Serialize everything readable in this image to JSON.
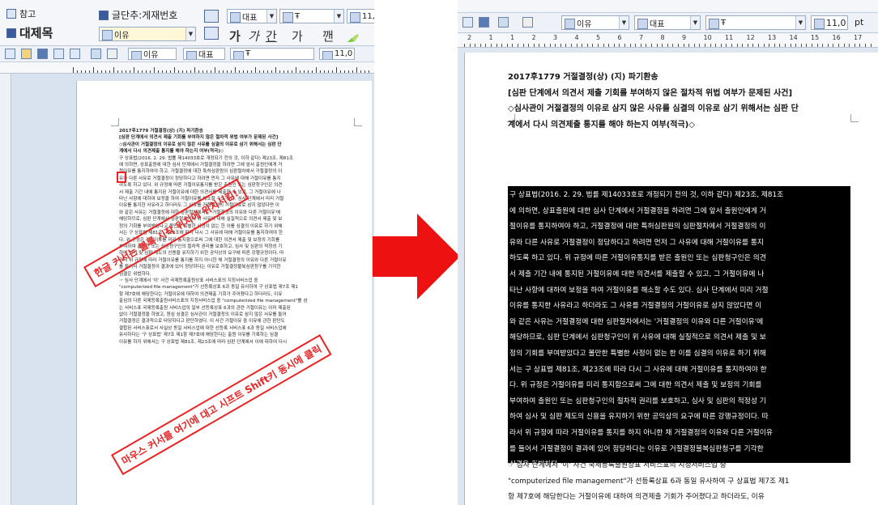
{
  "left": {
    "menu": {
      "ref": "참고",
      "heading": "대제목",
      "bullet_style": "글단추:게재번호",
      "style_combo": "이유",
      "style_combo2": "이유",
      "font_face": "대표",
      "font_face2": "대표",
      "font_name": "Ŧ",
      "font_name2": "Ŧ",
      "size_value": "11,0"
    },
    "format_buttons": [
      "가",
      "가",
      "간",
      "가",
      "깬"
    ],
    "callout_top": "한글 커서는 블록 시작 위치에 위치시킴!",
    "callout_bottom": "마우스 커서를 여기에 대고 시프트 Shift키 동시에 클릭"
  },
  "right": {
    "toolbar": {
      "style_combo": "이유",
      "font_face": "대표",
      "font_name": "Ŧ",
      "size_value": "11,0",
      "size_unit": "pt"
    },
    "ruler_numbers": [
      "2",
      "1",
      "1",
      "2",
      "3",
      "4",
      "5",
      "6",
      "7",
      "8",
      "9",
      "10",
      "11",
      "12",
      "13",
      "14",
      "15",
      "16",
      "17"
    ]
  },
  "doc": {
    "case_line": "2017후1779 거절결정(상) (지) 파기환송",
    "issue_line1": "[심판 단계에서 의견서 제출 기회를 부여하지 않은 절차적 위법 여부가 문제된 사건]",
    "issue_line2": "◇심사관이 거절결정의 이유로 삼지 않은 사유를 심결의 이유로 삼기 위해서는 심판 단",
    "issue_line3": "계에서 다시 의견제출 통지를 해야 하는지 여부(적극)◇",
    "selected_lines": [
      "구 상표법(2016. 2. 29. 법률 제14033호로 개정되기 전의 것, 이하 같다) 제23조, 제81조",
      "에 의하면, 상표출원에 대한 심사 단계에서 거절결정을 하려면 그에 앞서 출원인에게 거",
      "절이유를 통지하여야 하고, 거절결정에 대한 특허심판원의 심판절차에서 거절결정의 이",
      "유와 다른 사유로 거절결정이 정당하다고 하려면 먼저 그 사유에 대해 거절이유를 통지",
      "하도록 하고 있다. 위 규정에 따른 거절이유통지를 받은 출원인 또는 심판청구인은 의견",
      "서 제출 기간 내에 통지된 거절이유에 대한 의견서를 제출할 수 있고, 그 거절이유에 나",
      "타난 사항에 대하여 보정을 하여 거절이유를 해소할 수도 있다. 심사 단계에서 미리 거절",
      "이유를 통지한 사유라고 하더라도 그 사유를 거절결정의 거절이유로 삼지 않았다면 이",
      "와 같은 사유는 거절결정에 대한 심판절차에서는 '거절결정의 이유와 다른 거절이유'에",
      "해당하므로, 심판 단계에서 심판청구인이 위 사유에 대해 실질적으로 의견서 제출 및 보",
      "정의 기회를 부여받았다고 볼만한 특별한 사정이 없는 한 이를 심결의 이유로 하기 위해",
      "서는 구 상표법 제81조, 제23조에 따라 다시 그 사유에 대해 거절이유를 통지하여야 한",
      "다. 위 규정은 거절이유를 미리 통지함으로써 그에 대한 의견서 제출 및 보정의 기회를",
      "부여하여 출원인 또는 심판청구인의 절차적 권리를 보호하고, 심사 및 심판의 적정성 기",
      "하여 심사 및 심판 제도의 신용을 유지하기 위한 공익상의 요구에 따른 강행규정이다. 따",
      "라서 위 규정에 따라 거절이유를 통지를 하지 아니한 채 거절결정의 이유와 다른 거절이유",
      "를 들어서 거절결정이 결과에 있어 정당하다는 이유로 거절결정불복심판청구를 기각한",
      "심결은 위법하다."
    ],
    "after_lines": [
      "☞ 심사 단계에서 '이' 사건 국제등록출원상표 서비스표의 지정서비스업 중",
      "\"computerized file management\"가 선등록상표 6과 동일 유사하여 구 상표법 제7조 제1",
      "항 제7호에 해당한다는 거절이유에 대하여 의견제출 기회가 주어졌다고 하더라도, 이유"
    ],
    "small_after_lines": [
      "☞ 심사 단계에서 '이' 사건 국제등록출원상표 서비스표의 지정서비스업 중",
      "\"computerized file management\"가 선등록상표 6과 동일 유사하여 구 상표법 제7조 제1",
      "항 제7호에 해당한다는 거절이유에 대하여 의견제출 기회가 주어졌다고 하더라도, 이유",
      "출심의 다른 국제등록출원서비스표의 지정서비스업 중 \"computerized file management\"를 삼",
      "는 서비스표 국제등록출원 서비스업의 일부 선등록상표 6과의 관련 거절이유는 이미 제출된",
      "없이 거절결정을 하였고, 원심 심결은 심사관이 거절결정의 이유로 삼지 않은 사유를 들어",
      "거절결정은 결과적으로 타당하다고 판단하였다. 이 사건 거절이유 중 이유에 관한 판단도",
      "결합된 서비스표로서 사실상 동일 서비스업에 대한 선등록 서비스표 6과 동일 서비스업에",
      "유사하다는 '구 상표법' 제7조 제1항 제7호에 해당한다는 출원 이유를 기록하는 심결",
      "이유를 하지 위해서는 구 상표법 제81조, 제23조에 따라 심판 단계에서 이에 대하여 다시"
    ]
  }
}
